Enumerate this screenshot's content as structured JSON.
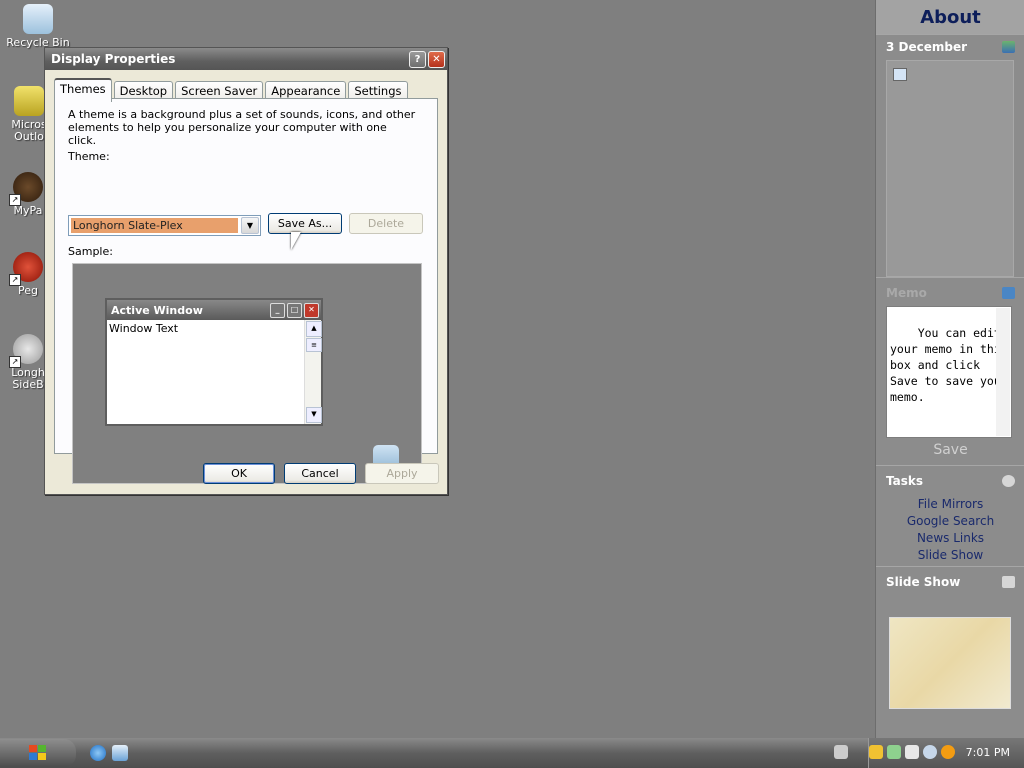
{
  "desktop": {
    "icons": [
      {
        "label": "Recycle Bin"
      },
      {
        "label": "Micros\nOutlo"
      },
      {
        "label": "MyPa"
      },
      {
        "label": "Peg"
      },
      {
        "label": "Longh\nSideB"
      }
    ]
  },
  "dialog": {
    "title": "Display Properties",
    "tabs": [
      "Themes",
      "Desktop",
      "Screen Saver",
      "Appearance",
      "Settings"
    ],
    "description": "A theme is a background plus a set of sounds, icons, and other elements to help you personalize your computer with one click.",
    "theme_label": "Theme:",
    "theme_value": "Longhorn Slate-Plex",
    "save_as_label": "Save As...",
    "delete_label": "Delete",
    "sample_label": "Sample:",
    "sample_window_title": "Active Window",
    "sample_window_text": "Window Text",
    "ok_label": "OK",
    "cancel_label": "Cancel",
    "apply_label": "Apply"
  },
  "sidebar": {
    "about_title": "About",
    "date_heading": "3 December",
    "memo_heading": "Memo",
    "memo_text": "You can edit your memo in this box and click Save to save your memo.",
    "memo_save": "Save",
    "tasks_heading": "Tasks",
    "tasks": [
      "File Mirrors",
      "Google Search",
      "News Links",
      "Slide Show"
    ],
    "slideshow_heading": "Slide Show"
  },
  "taskbar": {
    "clock": "7:01 PM"
  },
  "colors": {
    "desktop": "#7f7f7f",
    "theme_selection": "#e8a06c",
    "task_link": "#1a2a6c"
  }
}
